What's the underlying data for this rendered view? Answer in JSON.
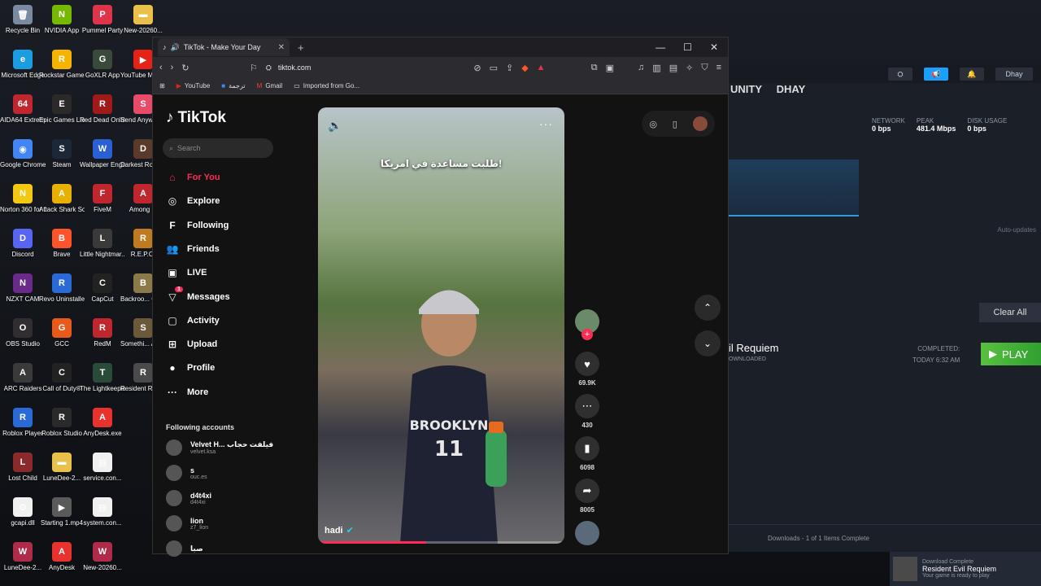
{
  "desktop": {
    "icons": [
      {
        "label": "Recycle Bin",
        "color": "#7a8aa0",
        "glyph": "🗑"
      },
      {
        "label": "NVIDIA App",
        "color": "#76b900",
        "glyph": "N"
      },
      {
        "label": "Pummel Party",
        "color": "#e0344a",
        "glyph": "P"
      },
      {
        "label": "New-20260...",
        "color": "#e8c04a",
        "glyph": "▬"
      },
      {
        "label": "Microsoft Edge",
        "color": "#1b9de2",
        "glyph": "e"
      },
      {
        "label": "Rockstar Games ...",
        "color": "#f4b400",
        "glyph": "R"
      },
      {
        "label": "GoXLR App",
        "color": "#3a4a3a",
        "glyph": "G"
      },
      {
        "label": "YouTube Music De...",
        "color": "#e62117",
        "glyph": "▶"
      },
      {
        "label": "AIDA64 Extreme",
        "color": "#c0262d",
        "glyph": "64"
      },
      {
        "label": "Epic Games Launcher",
        "color": "#2a2a2a",
        "glyph": "E"
      },
      {
        "label": "Red Dead Online",
        "color": "#a01a1a",
        "glyph": "R"
      },
      {
        "label": "Send Anywhe...",
        "color": "#e84a6a",
        "glyph": "S"
      },
      {
        "label": "Google Chrome",
        "color": "#4285f4",
        "glyph": "◉"
      },
      {
        "label": "Steam",
        "color": "#1b2838",
        "glyph": "S"
      },
      {
        "label": "Wallpaper Engine",
        "color": "#2a5fd6",
        "glyph": "W"
      },
      {
        "label": "Darkest Road (De...",
        "color": "#5a3a2a",
        "glyph": "D"
      },
      {
        "label": "Norton 360 for Gamers",
        "color": "#f2c811",
        "glyph": "N"
      },
      {
        "label": "Attack Shark Software",
        "color": "#e8b000",
        "glyph": "A"
      },
      {
        "label": "FiveM",
        "color": "#c0262d",
        "glyph": "F"
      },
      {
        "label": "Among ...",
        "color": "#c0262d",
        "glyph": "A"
      },
      {
        "label": "Discord",
        "color": "#5865f2",
        "glyph": "D"
      },
      {
        "label": "Brave",
        "color": "#fb542b",
        "glyph": "B"
      },
      {
        "label": "Little Nightmar...",
        "color": "#3a3a3a",
        "glyph": "L"
      },
      {
        "label": "R.E.P.O.",
        "color": "#c07a20",
        "glyph": "R"
      },
      {
        "label": "NZXT CAM",
        "color": "#6a2a8a",
        "glyph": "N"
      },
      {
        "label": "Revo Uninstaller",
        "color": "#2a6ad6",
        "glyph": "R"
      },
      {
        "label": "CapCut",
        "color": "#222222",
        "glyph": "C"
      },
      {
        "label": "Backroo... Compa...",
        "color": "#8a7a4a",
        "glyph": "B"
      },
      {
        "label": "OBS Studio",
        "color": "#302e31",
        "glyph": "O"
      },
      {
        "label": "GCC",
        "color": "#e85a1a",
        "glyph": "G"
      },
      {
        "label": "RedM",
        "color": "#c0262d",
        "glyph": "R"
      },
      {
        "label": "Somethi... Awful St...",
        "color": "#6a5a3a",
        "glyph": "S"
      },
      {
        "label": "ARC Raiders",
        "color": "#3a3a3a",
        "glyph": "A"
      },
      {
        "label": "Call of Duty®",
        "color": "#222222",
        "glyph": "C"
      },
      {
        "label": "The Lightkeeper",
        "color": "#2a4a3a",
        "glyph": "T"
      },
      {
        "label": "Resident Requie...",
        "color": "#4a4a4a",
        "glyph": "R"
      },
      {
        "label": "Roblox Player",
        "color": "#2a6ad6",
        "glyph": "R"
      },
      {
        "label": "Roblox Studio",
        "color": "#2a2a2a",
        "glyph": "R"
      },
      {
        "label": "AnyDesk.exe",
        "color": "#e8322e",
        "glyph": "A"
      },
      {
        "label": "",
        "color": "",
        "glyph": ""
      },
      {
        "label": "Lost Child",
        "color": "#8a2a2a",
        "glyph": "L"
      },
      {
        "label": "LuneDee-2...",
        "color": "#e8c04a",
        "glyph": "▬"
      },
      {
        "label": "service.con...",
        "color": "#f0f0f0",
        "glyph": "▤"
      },
      {
        "label": "",
        "color": "",
        "glyph": ""
      },
      {
        "label": "gcapi.dll",
        "color": "#f0f0f0",
        "glyph": "⚙"
      },
      {
        "label": "Starting 1.mp4",
        "color": "#5a5a5a",
        "glyph": "▶"
      },
      {
        "label": "system.con...",
        "color": "#f0f0f0",
        "glyph": "▤"
      },
      {
        "label": "",
        "color": "",
        "glyph": ""
      },
      {
        "label": "LuneDee-2...",
        "color": "#b02a4a",
        "glyph": "W"
      },
      {
        "label": "AnyDesk",
        "color": "#e8322e",
        "glyph": "A"
      },
      {
        "label": "New-20260...",
        "color": "#b02a4a",
        "glyph": "W"
      }
    ]
  },
  "steam": {
    "nav": [
      "UNITY",
      "DHAY"
    ],
    "user": "Dhay",
    "stats": [
      {
        "label": "NETWORK",
        "value": "0 bps"
      },
      {
        "label": "PEAK",
        "value": "481.4 Mbps"
      },
      {
        "label": "DISK USAGE",
        "value": "0 bps"
      }
    ],
    "auto_updates": "Auto-updates",
    "clear_all": "Clear All",
    "game_name": "il Requiem",
    "game_sub": "OWNLOADED",
    "completed_label": "COMPLETED:",
    "completed_time": "TODAY 6:32 AM",
    "play_label": "PLAY",
    "footer": "Downloads - 1 of 1 Items Complete"
  },
  "toast": {
    "title": "Download Complete",
    "game": "Resident Evil Requiem",
    "message": "Your game is ready to play"
  },
  "browser": {
    "tab_title": "TikTok - Make Your Day",
    "url": "tiktok.com",
    "bookmarks": [
      "YouTube",
      "ترجمة",
      "Gmail",
      "Imported from Go..."
    ]
  },
  "tiktok": {
    "logo": "TikTok",
    "search_placeholder": "Search",
    "nav": [
      {
        "label": "For You",
        "icon": "home-icon",
        "glyph": "⌂",
        "active": true
      },
      {
        "label": "Explore",
        "icon": "compass-icon",
        "glyph": "◎",
        "active": false
      },
      {
        "label": "Following",
        "icon": "following-icon",
        "glyph": "F",
        "active": false
      },
      {
        "label": "Friends",
        "icon": "friends-icon",
        "glyph": "👥",
        "active": false
      },
      {
        "label": "LIVE",
        "icon": "live-icon",
        "glyph": "▣",
        "active": false
      },
      {
        "label": "Messages",
        "icon": "messages-icon",
        "glyph": "▽",
        "active": false,
        "badge": "1"
      },
      {
        "label": "Activity",
        "icon": "activity-icon",
        "glyph": "▢",
        "active": false
      },
      {
        "label": "Upload",
        "icon": "upload-icon",
        "glyph": "⊞",
        "active": false
      },
      {
        "label": "Profile",
        "icon": "profile-icon",
        "glyph": "●",
        "active": false
      },
      {
        "label": "More",
        "icon": "more-icon",
        "glyph": "···",
        "active": false
      }
    ],
    "following_title": "Following accounts",
    "accounts": [
      {
        "name": "Velvet H... فيلفت حجاب",
        "handle": "velvet.ksa"
      },
      {
        "name": "s",
        "handle": "ouc.es"
      },
      {
        "name": "d4t4xi",
        "handle": "d4t4xi"
      },
      {
        "name": "lion",
        "handle": "z7_lion"
      },
      {
        "name": "صبا",
        "handle": ""
      }
    ],
    "video": {
      "caption": "طلبت مساعدة في امريكا!",
      "author": "hadi",
      "progress": 0.44
    },
    "actions": [
      {
        "icon": "heart-icon",
        "glyph": "♥",
        "count": "69.9K"
      },
      {
        "icon": "comment-icon",
        "glyph": "⋯",
        "count": "430"
      },
      {
        "icon": "bookmark-icon",
        "glyph": "▮",
        "count": "6098"
      },
      {
        "icon": "share-icon",
        "glyph": "➦",
        "count": "8005"
      }
    ]
  }
}
